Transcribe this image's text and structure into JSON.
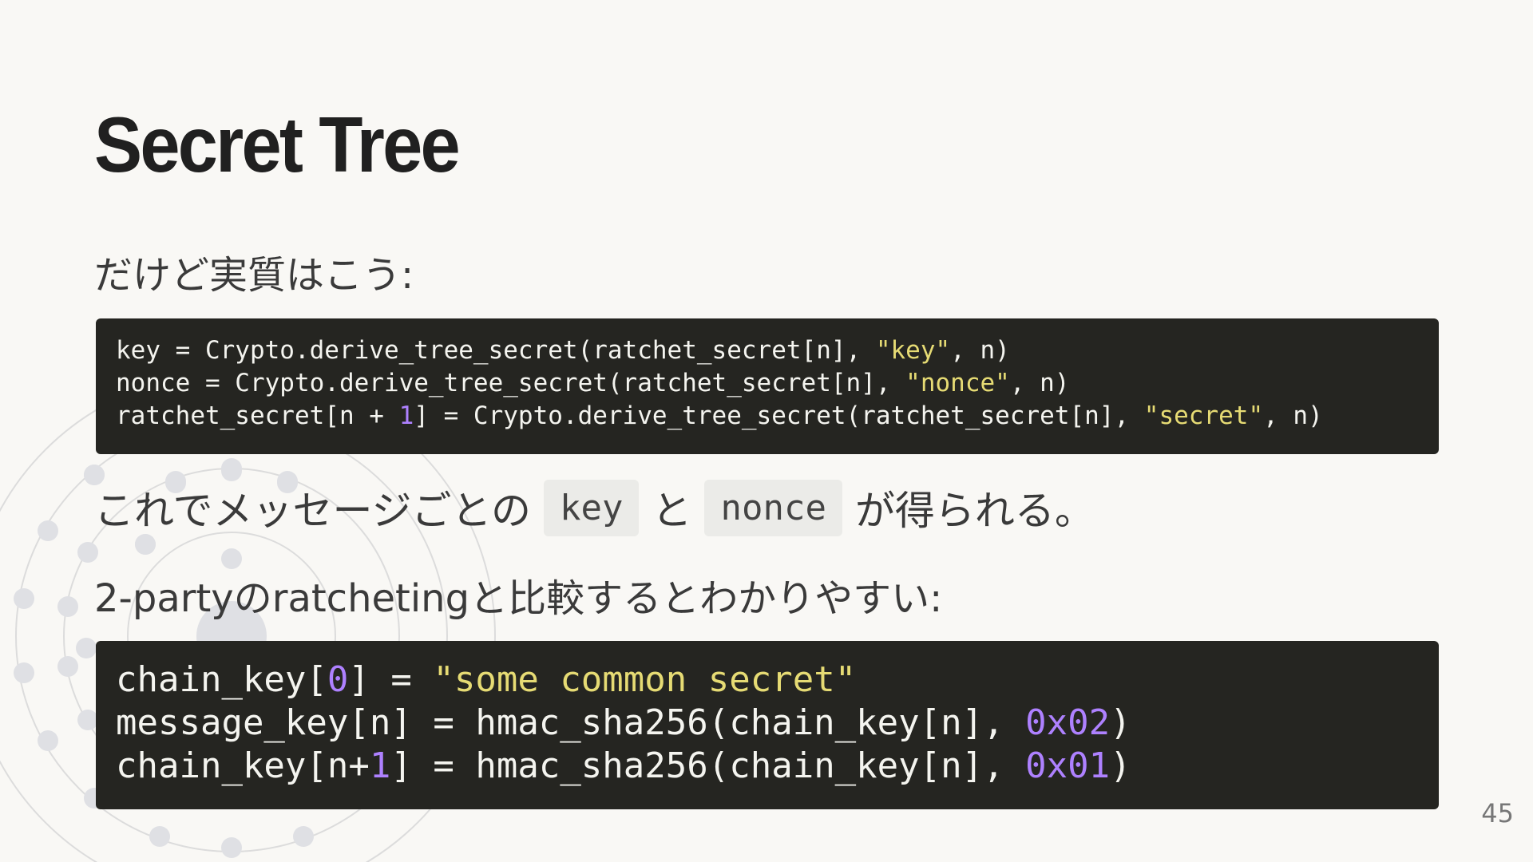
{
  "slide": {
    "title": "Secret Tree",
    "page_number": "45"
  },
  "text": {
    "intro": "だけど実質はこう:",
    "result_prefix": "これでメッセージごとの",
    "result_code_key": "key",
    "result_mid": "と",
    "result_code_nonce": "nonce",
    "result_suffix": "が得られる。",
    "compare": "2-partyのratchetingと比較するとわかりやすい:"
  },
  "code_block_1": {
    "line1": {
      "a": "key = Crypto.derive_tree_secret(ratchet_secret[n], ",
      "str": "\"key\"",
      "b": ", n)"
    },
    "line2": {
      "a": "nonce = Crypto.derive_tree_secret(ratchet_secret[n], ",
      "str": "\"nonce\"",
      "b": ", n)"
    },
    "line3": {
      "a": "ratchet_secret[n + ",
      "num": "1",
      "b": "] = Crypto.derive_tree_secret(ratchet_secret[n], ",
      "str": "\"secret\"",
      "c": ", n)"
    }
  },
  "code_block_2": {
    "line1": {
      "a": "chain_key[",
      "num": "0",
      "b": "] = ",
      "str": "\"some common secret\""
    },
    "line2": {
      "a": "message_key[n] = hmac_sha256(chain_key[n], ",
      "num": "0x02",
      "b": ")"
    },
    "line3": {
      "a": "chain_key[n+",
      "num": "1",
      "b": "] = hmac_sha256(chain_key[n], ",
      "num2": "0x01",
      "c": ")"
    }
  },
  "colors": {
    "background": "#f9f8f5",
    "code_background": "#252521",
    "code_string": "#e6db74",
    "code_number": "#ae81ff"
  }
}
